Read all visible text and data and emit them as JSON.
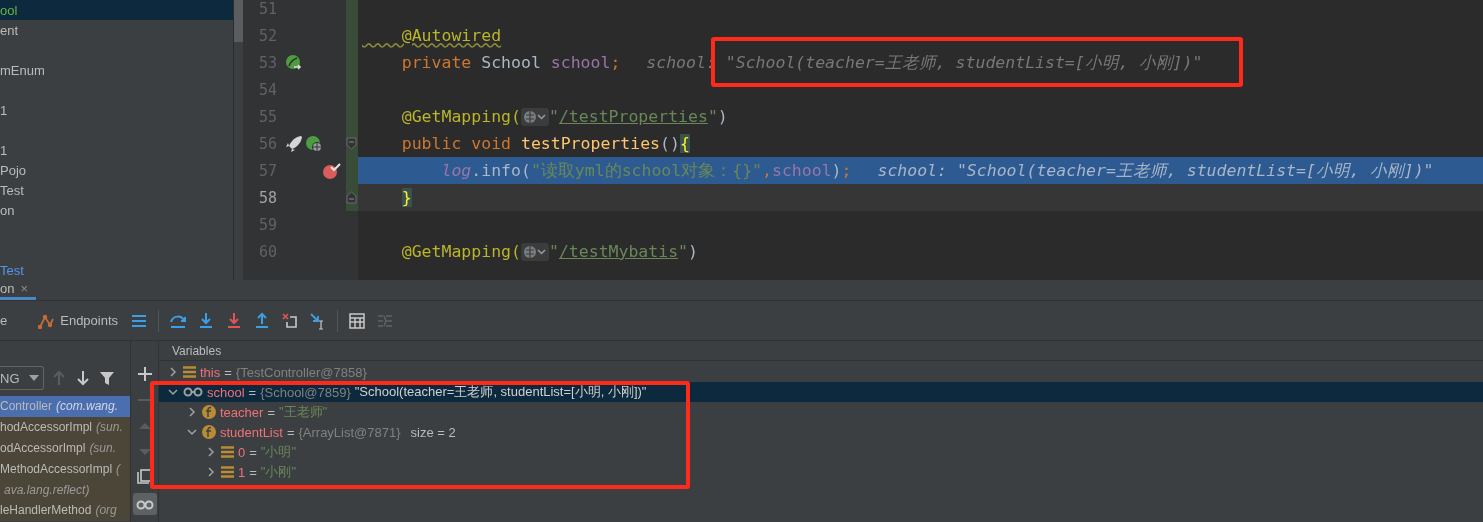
{
  "project_tree": {
    "items": [
      {
        "kind": "file",
        "label": "ool",
        "selected": true,
        "color": "#62b543"
      },
      {
        "kind": "file",
        "label": "ent",
        "selected": false,
        "color": "#bbbbbb"
      },
      {
        "kind": "empty"
      },
      {
        "kind": "file",
        "label": "mEnum",
        "selected": false,
        "color": "#bbbbbb"
      },
      {
        "kind": "empty"
      },
      {
        "kind": "file",
        "label": "1",
        "selected": false,
        "color": "#bbbbbb"
      },
      {
        "kind": "empty"
      },
      {
        "kind": "file",
        "label": "1",
        "selected": false,
        "color": "#bbbbbb"
      },
      {
        "kind": "file",
        "label": "Pojo",
        "selected": false,
        "color": "#bbbbbb"
      },
      {
        "kind": "file",
        "label": "Test",
        "selected": false,
        "color": "#bbbbbb"
      },
      {
        "kind": "file",
        "label": "on",
        "selected": false,
        "color": "#bbbbbb"
      },
      {
        "kind": "empty"
      },
      {
        "kind": "empty"
      },
      {
        "kind": "file",
        "label": "Test",
        "selected": false,
        "color": "#5394ec"
      }
    ]
  },
  "editor": {
    "lines": [
      {
        "number": "51",
        "current": false,
        "execution": false
      },
      {
        "number": "52",
        "current": false,
        "execution": false,
        "tokens": [
          {
            "kind": "annotation-warn",
            "text": "    @Autowired"
          }
        ]
      },
      {
        "number": "53",
        "current": false,
        "execution": false,
        "gutter": [
          {
            "kind": "bean"
          }
        ],
        "tokens": [
          {
            "kind": "keyword",
            "text": "    private "
          },
          {
            "kind": "plain",
            "text": "School "
          },
          {
            "kind": "field",
            "text": "school"
          },
          {
            "kind": "keyword",
            "text": ";"
          }
        ],
        "hint": "school: \"School(teacher=王老师, studentList=[小明, 小刚])\""
      },
      {
        "number": "54",
        "current": false,
        "execution": false
      },
      {
        "number": "55",
        "current": false,
        "execution": false,
        "tokens": [
          {
            "kind": "annotation",
            "text": "    @GetMapping("
          },
          {
            "kind": "globe"
          },
          {
            "kind": "string",
            "text": "\""
          },
          {
            "kind": "url",
            "text": "/testProperties"
          },
          {
            "kind": "string",
            "text": "\""
          },
          {
            "kind": "plain",
            "text": ")"
          }
        ]
      },
      {
        "number": "56",
        "current": false,
        "execution": false,
        "gutter": [
          {
            "kind": "run"
          },
          {
            "kind": "web"
          }
        ],
        "fold": {
          "kind": "start"
        },
        "tokens": [
          {
            "kind": "keyword",
            "text": "    public void "
          },
          {
            "kind": "method-decl",
            "text": "testProperties"
          },
          {
            "kind": "plain",
            "text": "()"
          },
          {
            "kind": "brace-match",
            "text": "{"
          }
        ]
      },
      {
        "number": "57",
        "current": false,
        "execution": true,
        "gutter": [
          {
            "kind": "breakpoint"
          }
        ],
        "tokens": [
          {
            "kind": "static-field",
            "text": "        log"
          },
          {
            "kind": "plain",
            "text": ".info("
          },
          {
            "kind": "string",
            "text": "\"读取yml的school对象：{}\""
          },
          {
            "kind": "keyword",
            "text": ","
          },
          {
            "kind": "field",
            "text": "school"
          },
          {
            "kind": "plain",
            "text": ")"
          },
          {
            "kind": "keyword",
            "text": ";"
          }
        ],
        "hint": "school: \"School(teacher=王老师, studentList=[小明, 小刚])\""
      },
      {
        "number": "58",
        "current": true,
        "execution": false,
        "fold": {
          "kind": "end"
        },
        "tokens": [
          {
            "kind": "brace-match",
            "text": "    }"
          }
        ]
      },
      {
        "number": "59",
        "current": false,
        "execution": false
      },
      {
        "number": "60",
        "current": false,
        "execution": false,
        "tokens": [
          {
            "kind": "annotation",
            "text": "    @GetMapping("
          },
          {
            "kind": "globe"
          },
          {
            "kind": "string",
            "text": "\""
          },
          {
            "kind": "url",
            "text": "/testMybatis"
          },
          {
            "kind": "string",
            "text": "\""
          },
          {
            "kind": "plain",
            "text": ")"
          }
        ]
      }
    ]
  },
  "tool_window": {
    "tab": {
      "label": "on",
      "close": "×"
    },
    "toolbar": [
      {
        "kind": "text",
        "label": "e"
      },
      {
        "kind": "endpoints",
        "label": "Endpoints"
      },
      {
        "kind": "menu"
      },
      {
        "kind": "separator"
      },
      {
        "kind": "step-over"
      },
      {
        "kind": "step-into"
      },
      {
        "kind": "force-step-into"
      },
      {
        "kind": "step-out"
      },
      {
        "kind": "drop-frame"
      },
      {
        "kind": "run-to-cursor"
      },
      {
        "kind": "separator"
      },
      {
        "kind": "evaluate"
      },
      {
        "kind": "trace"
      }
    ],
    "thread_select": {
      "value": "NG"
    },
    "frame_buttons": [
      {
        "kind": "up",
        "disabled": true
      },
      {
        "kind": "down",
        "disabled": false
      },
      {
        "kind": "filter",
        "disabled": false
      }
    ],
    "frames": [
      {
        "method": "Controller",
        "location": "(com.wang.",
        "selected": true,
        "library": false
      },
      {
        "method": "hodAccessorImpl",
        "location": "(sun.",
        "selected": false,
        "library": true
      },
      {
        "method": "odAccessorImpl",
        "location": "(sun.",
        "selected": false,
        "library": true
      },
      {
        "method": "MethodAccessorImpl",
        "location": "(",
        "selected": false,
        "library": true
      },
      {
        "location": "ava.lang.reflect)",
        "selected": false,
        "library": true
      },
      {
        "method": "leHandlerMethod",
        "location": "(org",
        "selected": false,
        "library": true
      }
    ],
    "side_buttons": [
      {
        "kind": "add",
        "disabled": false,
        "on": false
      },
      {
        "kind": "remove",
        "disabled": true,
        "on": false
      },
      {
        "kind": "up",
        "disabled": true,
        "on": false
      },
      {
        "kind": "down",
        "disabled": true,
        "on": false
      },
      {
        "kind": "copy",
        "disabled": false,
        "on": false
      },
      {
        "kind": "watches",
        "disabled": false,
        "on": true
      }
    ],
    "variables": {
      "title": "Variables",
      "tree": [
        {
          "kind": "list",
          "name": "this",
          "operator": "=",
          "ref": "{TestController@7858}",
          "expanded": false,
          "selected": false
        },
        {
          "kind": "watch",
          "name": "school",
          "operator": "=",
          "ref": "{School@7859}",
          "value": {
            "kind": "object",
            "text": "\"School(teacher=王老师, studentList=[小明, 小刚])\""
          },
          "expanded": true,
          "selected": true,
          "children": [
            {
              "kind": "field",
              "name": "teacher",
              "operator": "=",
              "value": {
                "kind": "string",
                "text": "\"王老师\""
              },
              "expanded": false,
              "selected": false
            },
            {
              "kind": "field",
              "name": "studentList",
              "operator": "=",
              "ref": "{ArrayList@7871}",
              "extra": "size = 2",
              "expanded": true,
              "selected": false,
              "children": [
                {
                  "kind": "list",
                  "name": "0",
                  "operator": "=",
                  "value": {
                    "kind": "string",
                    "text": "\"小明\""
                  },
                  "expanded": false,
                  "selected": false
                },
                {
                  "kind": "list",
                  "name": "1",
                  "operator": "=",
                  "value": {
                    "kind": "string",
                    "text": "\"小刚\""
                  },
                  "expanded": false,
                  "selected": false
                }
              ]
            }
          ]
        }
      ]
    }
  }
}
